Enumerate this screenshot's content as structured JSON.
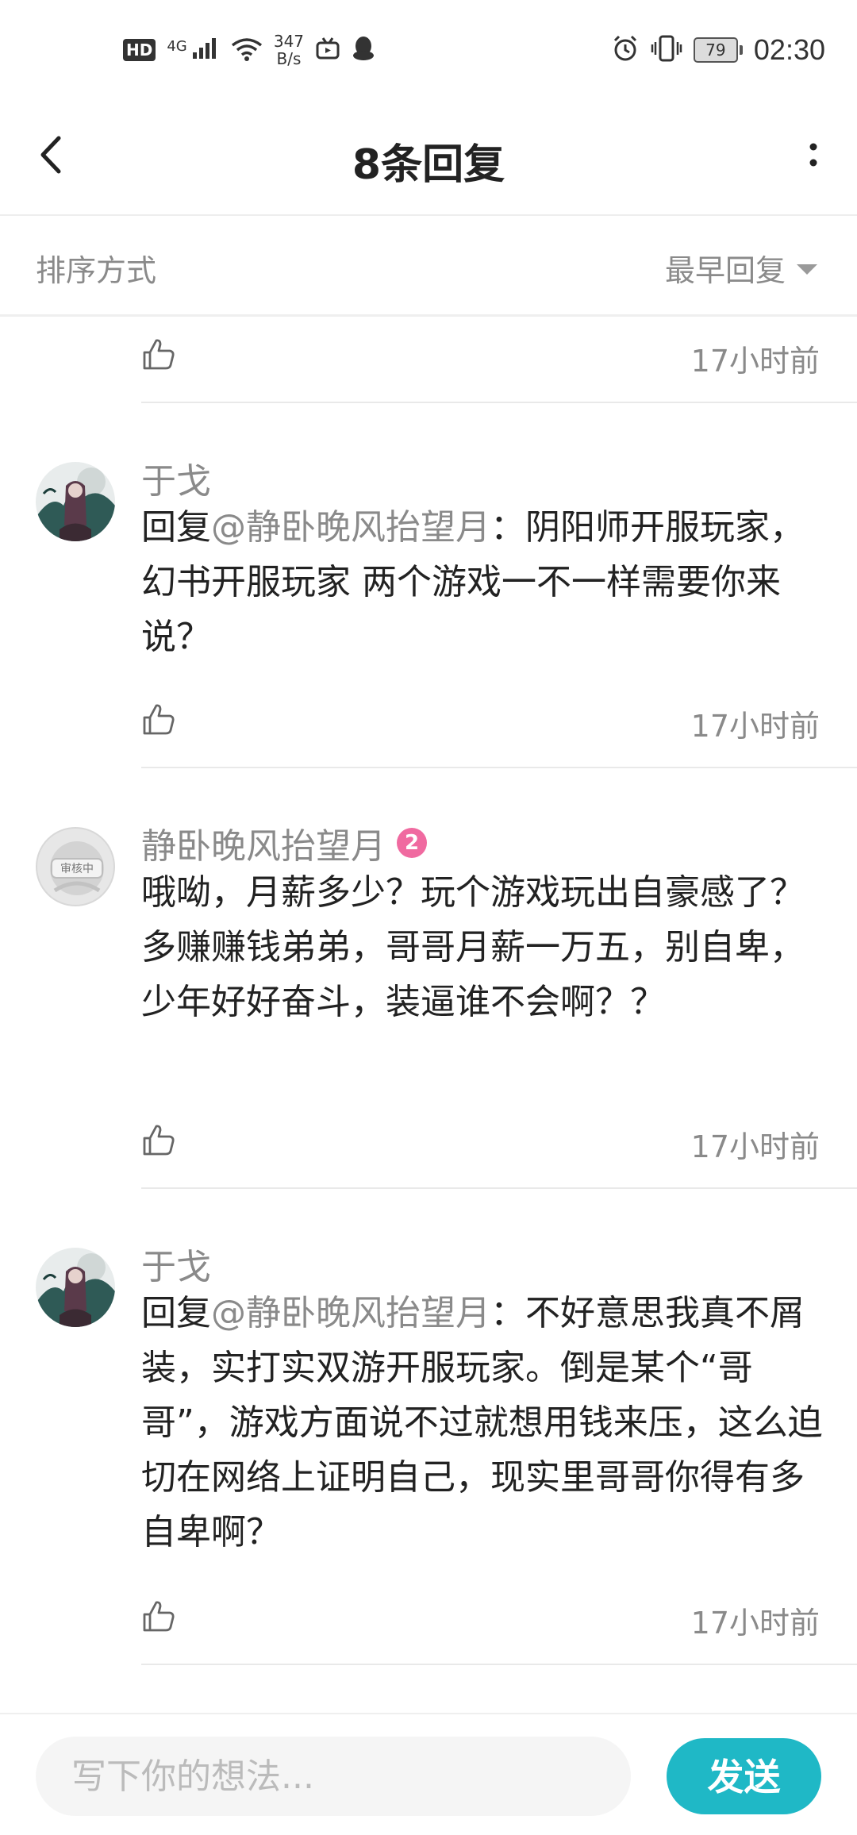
{
  "status_bar": {
    "hd": "HD",
    "net_type": "4G",
    "speed_value": "347",
    "speed_unit": "B/s",
    "battery": "79",
    "time": "02:30"
  },
  "header": {
    "title": "8条回复"
  },
  "sort": {
    "label": "排序方式",
    "value": "最早回复"
  },
  "comments": [
    {
      "like_count": "",
      "timestamp": "17小时前"
    },
    {
      "username": "于戈",
      "reply_prefix": "回复",
      "mention": "@静卧晚风抬望月",
      "text": "：阴阳师开服玩家，幻书开服玩家 两个游戏一不一样需要你来说？",
      "timestamp": "17小时前"
    },
    {
      "username": "静卧晚风抬望月",
      "level": "2",
      "avatar_label": "审核中",
      "text": "哦呦，月薪多少？玩个游戏玩出自豪感了？多赚赚钱弟弟，哥哥月薪一万五，别自卑，少年好好奋斗，装逼谁不会啊？？",
      "timestamp": "17小时前"
    },
    {
      "username": "于戈",
      "reply_prefix": "回复",
      "mention": "@静卧晚风抬望月",
      "text": "：不好意思我真不屑装，实打实双游开服玩家。倒是某个“哥哥”，游戏方面说不过就想用钱来压，这么迫切在网络上证明自己，现实里哥哥你得有多自卑啊？",
      "timestamp": "17小时前"
    }
  ],
  "input": {
    "placeholder": "写下你的想法...",
    "send_label": "发送"
  },
  "colors": {
    "accent": "#1fb8c6",
    "muted_text": "#8a8a8a",
    "badge": "#f06aa0"
  }
}
